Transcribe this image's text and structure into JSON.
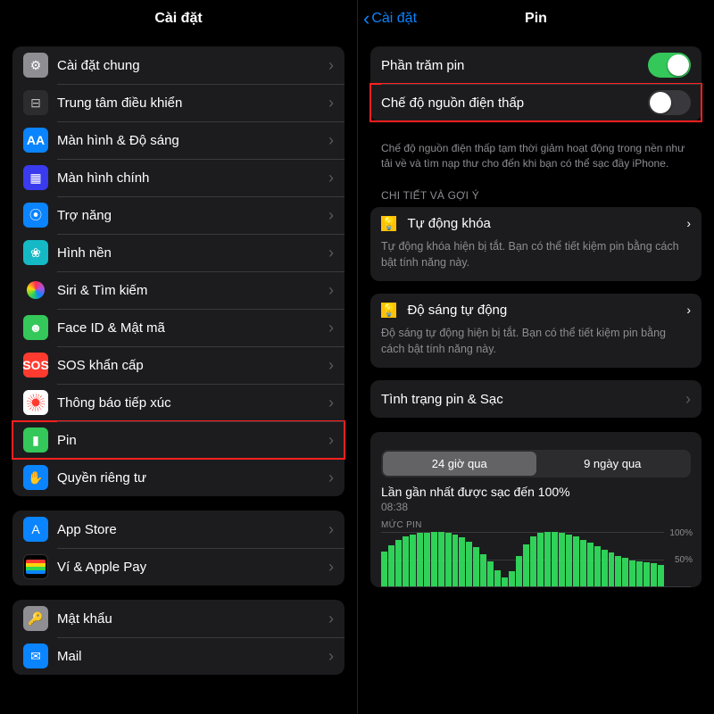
{
  "left": {
    "title": "Cài đặt",
    "items": [
      {
        "label": "Cài đặt chung",
        "iconClass": "ic-gear",
        "glyph": "⚙",
        "name": "row-general"
      },
      {
        "label": "Trung tâm điều khiển",
        "iconClass": "ic-cc",
        "glyph": "⊟",
        "name": "row-control-center"
      },
      {
        "label": "Màn hình & Độ sáng",
        "iconClass": "ic-aa",
        "glyph": "AA",
        "name": "row-display-brightness"
      },
      {
        "label": "Màn hình chính",
        "iconClass": "ic-home",
        "glyph": "▦",
        "name": "row-home-screen"
      },
      {
        "label": "Trợ năng",
        "iconClass": "ic-acc",
        "glyph": "⦿",
        "name": "row-accessibility"
      },
      {
        "label": "Hình nền",
        "iconClass": "ic-wall",
        "glyph": "❀",
        "name": "row-wallpaper"
      },
      {
        "label": "Siri & Tìm kiếm",
        "iconClass": "ic-siri",
        "glyph": "",
        "name": "row-siri-search"
      },
      {
        "label": "Face ID & Mật mã",
        "iconClass": "ic-face",
        "glyph": "☻",
        "name": "row-faceid-passcode"
      },
      {
        "label": "SOS khẩn cấp",
        "iconClass": "ic-sos",
        "glyph": "SOS",
        "name": "row-emergency-sos"
      },
      {
        "label": "Thông báo tiếp xúc",
        "iconClass": "ic-expo",
        "glyph": "",
        "name": "row-exposure-notifications"
      },
      {
        "label": "Pin",
        "iconClass": "ic-batt",
        "glyph": "▮",
        "name": "row-battery",
        "highlight": true
      },
      {
        "label": "Quyền riêng tư",
        "iconClass": "ic-priv",
        "glyph": "✋",
        "name": "row-privacy"
      }
    ],
    "group2": [
      {
        "label": "App Store",
        "iconClass": "ic-as",
        "glyph": "A",
        "name": "row-app-store"
      },
      {
        "label": "Ví & Apple Pay",
        "iconClass": "ic-wal",
        "glyph": "",
        "name": "row-wallet-applepay"
      }
    ],
    "group3": [
      {
        "label": "Mật khẩu",
        "iconClass": "ic-pass",
        "glyph": "🔑",
        "name": "row-passwords"
      },
      {
        "label": "Mail",
        "iconClass": "ic-mail",
        "glyph": "✉",
        "name": "row-mail"
      }
    ]
  },
  "right": {
    "back": "Cài đặt",
    "title": "Pin",
    "toggles": {
      "percent": {
        "label": "Phần trăm pin",
        "on": true
      },
      "lowpower": {
        "label": "Chế độ nguồn điện thấp",
        "on": false
      }
    },
    "lowpower_note": "Chế độ nguồn điện thấp tạm thời giảm hoạt động trong nền như tải về và tìm nạp thư cho đến khi bạn có thể sạc đầy iPhone.",
    "suggestions_header": "CHI TIẾT VÀ GỢI Ý",
    "sugg": [
      {
        "title": "Tự động khóa",
        "desc": "Tự động khóa hiện bị tắt. Bạn có thể tiết kiệm pin bằng cách bật tính năng này."
      },
      {
        "title": "Độ sáng tự động",
        "desc": "Độ sáng tự động hiện bị tắt. Bạn có thể tiết kiệm pin bằng cách bật tính năng này."
      }
    ],
    "health_label": "Tình trạng pin & Sạc",
    "seg": {
      "a": "24 giờ qua",
      "b": "9 ngày qua"
    },
    "last_charge": "Lần gần nhất được sạc đến 100%",
    "last_time": "08:38",
    "chart_label": "MỨC PIN",
    "grid100": "100%",
    "grid50": "50%"
  },
  "chart_data": {
    "type": "bar",
    "title": "MỨC PIN",
    "ylabel": "%",
    "ylim": [
      0,
      100
    ],
    "categories_note": "hourly over last 24h",
    "values": [
      64,
      76,
      86,
      92,
      96,
      98,
      99,
      100,
      100,
      99,
      96,
      90,
      82,
      72,
      60,
      46,
      30,
      16,
      28,
      56,
      78,
      92,
      98,
      100,
      100,
      99,
      96,
      92,
      86,
      80,
      74,
      68,
      62,
      56,
      52,
      48,
      46,
      44,
      42,
      40
    ]
  }
}
